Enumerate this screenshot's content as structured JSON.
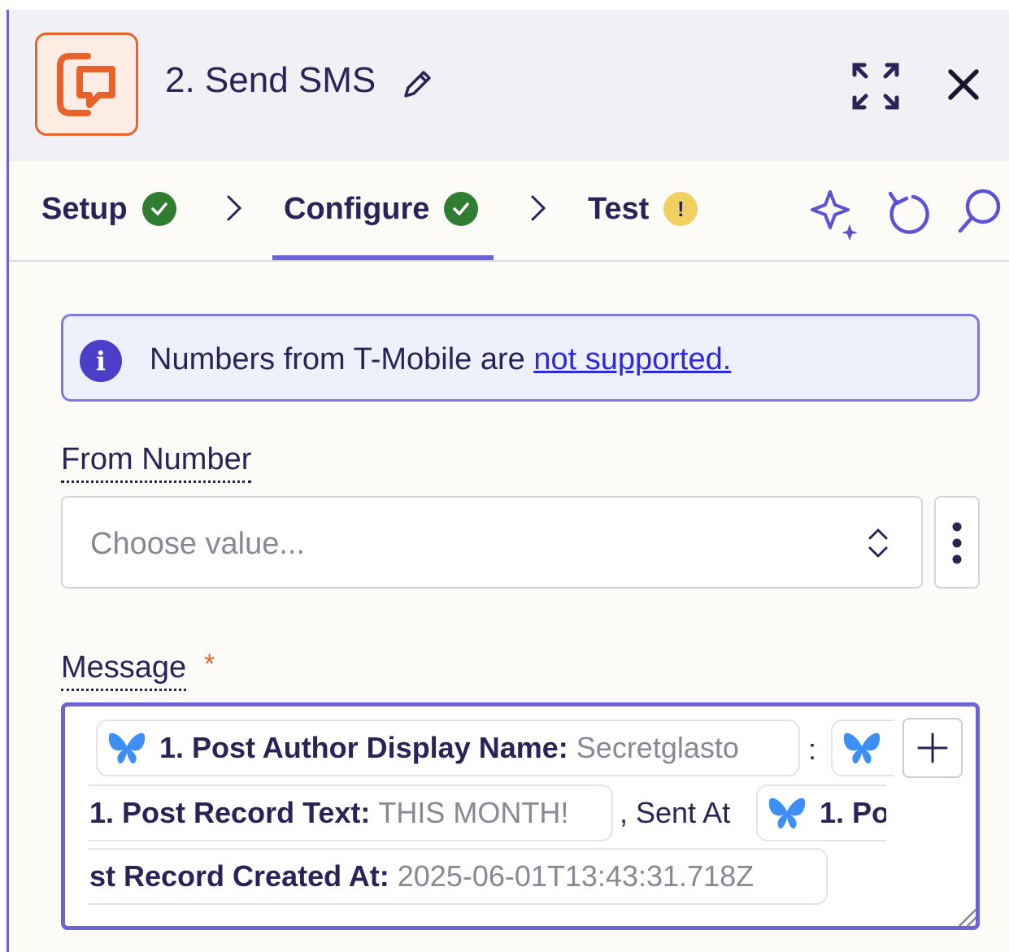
{
  "header": {
    "title": "2. Send SMS",
    "app_icon": "sms-chat-icon",
    "brand_color": "#e8622b"
  },
  "tabs": [
    {
      "label": "Setup",
      "status": "complete"
    },
    {
      "label": "Configure",
      "status": "complete",
      "active": true
    },
    {
      "label": "Test",
      "status": "warning",
      "badge": "!"
    }
  ],
  "toolbar_icons": [
    "ai-sparkle-icon",
    "undo-icon",
    "search-icon"
  ],
  "banner": {
    "text": "Numbers from T-Mobile are ",
    "link": "not supported."
  },
  "from_number": {
    "label": "From Number",
    "placeholder": "Choose value..."
  },
  "message": {
    "label": "Message",
    "required_mark": "*",
    "tokens": {
      "author": {
        "key": "1. Post Author Display Name:",
        "value": "Secretglasto"
      },
      "separator": ":",
      "record_text": {
        "key": "1. Post Record Text:",
        "value": "THIS MONTH!"
      },
      "sent_at": ", Sent At",
      "created_at_part1": "1. Po",
      "created_at_part2": {
        "key": "st Record Created At:",
        "value": "2025-06-01T13:43:31.718Z"
      }
    }
  },
  "colors": {
    "accent": "#6b63d6",
    "success": "#2e7d32",
    "warning": "#f0d060",
    "link": "#2f2ad8"
  }
}
